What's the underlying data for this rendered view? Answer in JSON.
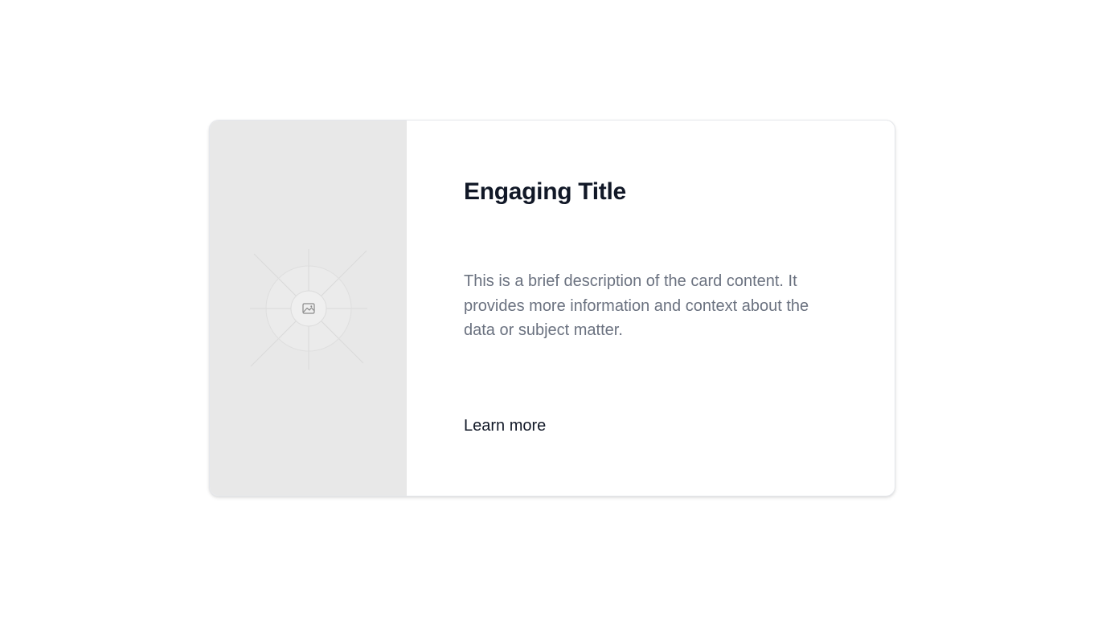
{
  "card": {
    "title": "Engaging Title",
    "description": "This is a brief description of the card content. It provides more information and context about the data or subject matter.",
    "link_label": "Learn more",
    "media": {
      "icon": "image-placeholder-icon",
      "background_color": "#e8e8e8"
    }
  },
  "colors": {
    "title": "#111827",
    "description": "#6b7280",
    "link": "#111827",
    "card_border": "#e5e7eb"
  }
}
